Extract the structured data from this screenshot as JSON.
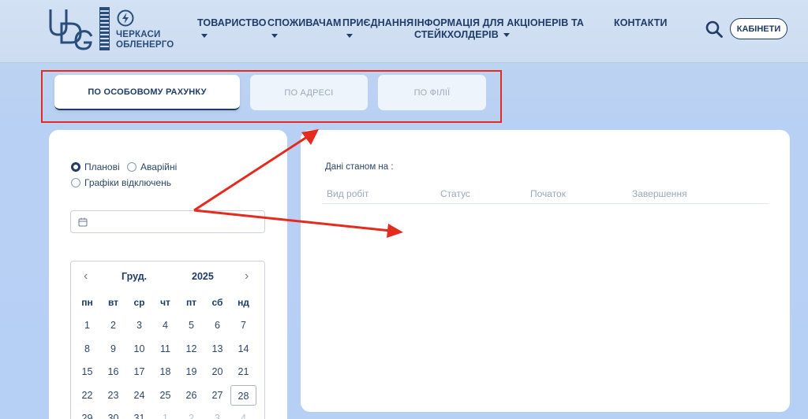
{
  "logo": {
    "mark": "UDG",
    "name_line1": "ЧЕРКАСИ",
    "name_line2": "ОБЛЕНЕРГО",
    "icon": "lightning-bolt-icon"
  },
  "nav": {
    "items": [
      {
        "label": "ТОВАРИСТВО",
        "dropdown": true
      },
      {
        "label": "СПОЖИВАЧАМ",
        "dropdown": true
      },
      {
        "label": "ПРИЄДНАННЯ",
        "dropdown": true
      },
      {
        "label_line1": "ІНФОРМАЦІЯ ДЛЯ АКЦІОНЕРІВ ТА",
        "label_line2": "СТЕЙКХОЛДЕРІВ",
        "dropdown": true
      },
      {
        "label": "КОНТАКТИ",
        "dropdown": false
      }
    ],
    "search_icon": "search-icon",
    "cabinet_label": "КАБІНЕТИ"
  },
  "tabs": [
    {
      "label": "ПО ОСОБОВОМУ РАХУНКУ",
      "active": true
    },
    {
      "label": "ПО АДРЕСІ",
      "active": false
    },
    {
      "label": "ПО ФІЛІЇ",
      "active": false
    }
  ],
  "filters": {
    "options": [
      {
        "label": "Планові",
        "checked": true
      },
      {
        "label": "Аварійні",
        "checked": false
      },
      {
        "label": "Графіки відключень",
        "checked": false
      }
    ],
    "date_value": ""
  },
  "calendar": {
    "month": "Груд.",
    "year": "2025",
    "weekdays": [
      "пн",
      "вт",
      "ср",
      "чт",
      "пт",
      "сб",
      "нд"
    ],
    "weeks": [
      [
        "1",
        "2",
        "3",
        "4",
        "5",
        "6",
        "7"
      ],
      [
        "8",
        "9",
        "10",
        "11",
        "12",
        "13",
        "14"
      ],
      [
        "15",
        "16",
        "17",
        "18",
        "19",
        "20",
        "21"
      ],
      [
        "22",
        "23",
        "24",
        "25",
        "26",
        "27",
        "28"
      ],
      [
        "29",
        "30",
        "31",
        "1",
        "2",
        "3",
        "4"
      ]
    ],
    "today": "28"
  },
  "results": {
    "data_as_of": "Дані станом на :",
    "columns": [
      "Вид робіт",
      "Статус",
      "Початок",
      "Завершення"
    ]
  },
  "colors": {
    "accent": "#1f3d66",
    "annotation": "#e42b1e",
    "background": "#b8d0f3"
  }
}
